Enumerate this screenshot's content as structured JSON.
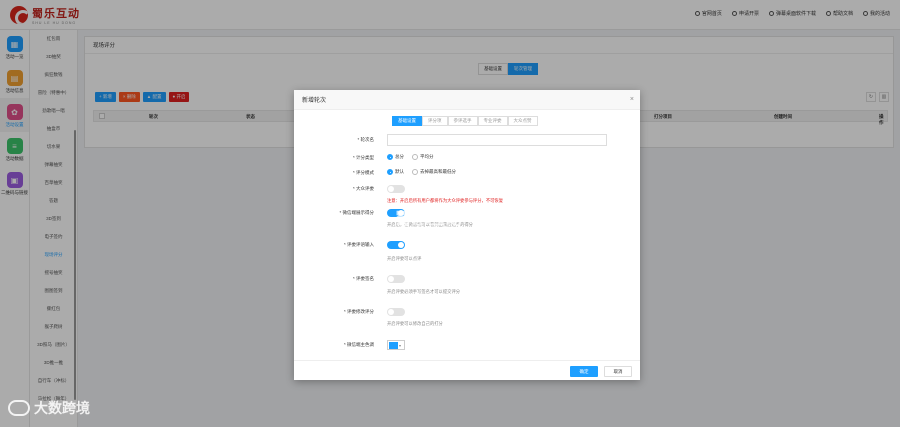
{
  "brand": {
    "name_cn": "蜀乐互动",
    "name_en": "SHU LE HU DONG",
    "color": "#c0201a"
  },
  "topnav": [
    {
      "icon": "home-icon",
      "label": "官网首页"
    },
    {
      "icon": "doc-icon",
      "label": "申请开票"
    },
    {
      "icon": "download-icon",
      "label": "弹幕桌面软件下载"
    },
    {
      "icon": "help-icon",
      "label": "帮助文档"
    },
    {
      "icon": "user-icon",
      "label": "我的活动"
    }
  ],
  "leftnav": [
    {
      "icon": "grid-icon",
      "label": "活动一览",
      "color": "#1e9fff"
    },
    {
      "icon": "document-icon",
      "label": "活动信息",
      "color": "#f0a030"
    },
    {
      "icon": "gear-icon",
      "label": "活动设置",
      "color": "#e0508a",
      "active": true
    },
    {
      "icon": "database-icon",
      "label": "活动数据",
      "color": "#3cc36a"
    },
    {
      "icon": "qrcode-icon",
      "label": "二维码与链接",
      "color": "#9c5de0"
    }
  ],
  "subnav": [
    "红包雨",
    "3D抽奖",
    "疯狂数钱",
    "冒险（特惠中）",
    "劲歌唱一唱",
    "抽盒币",
    "切水果",
    "弹幕抽奖",
    "百草抽奖",
    "答题",
    "3D签到",
    "电子签约",
    "现场评分",
    "摇号抽奖",
    "图图签到",
    "撕红包",
    "猴子爬树",
    "3D照马（图片）",
    "3D推一推",
    "自行车（冲标）",
    "马拉松（舞年）"
  ],
  "subnav_active": 12,
  "page": {
    "breadcrumb": "现场评分",
    "segments": [
      "基础设置",
      "轮次管理"
    ],
    "segment_active": 1,
    "actions": [
      {
        "label": "+ 新增",
        "color": "#1e9fff"
      },
      {
        "label": "× 删除",
        "color": "#ff5722"
      },
      {
        "label": "▲ 配置",
        "color": "#1e9fff"
      },
      {
        "label": "● 开启",
        "color": "#e02020"
      }
    ],
    "columns": [
      "轮次",
      "状态",
      "打分项目",
      "创建时间",
      "操作"
    ]
  },
  "dialog": {
    "title": "新增轮次",
    "close": "×",
    "tabs": [
      "基础设置",
      "评分项",
      "参评选手",
      "专业评委",
      "大众点赞"
    ],
    "tab_active": 0,
    "fields": {
      "round_name": {
        "label": "* 轮次名",
        "value": "",
        "placeholder": ""
      },
      "score_type": {
        "label": "* 计分类型",
        "options": [
          "总分",
          "平均分"
        ],
        "selected": 0
      },
      "judge_mode": {
        "label": "* 评分模式",
        "options": [
          "默认",
          "去掉最高和最低分"
        ],
        "selected": 0
      },
      "public_judge": {
        "label": "* 大众评委",
        "on": false,
        "hint": "注意：开启后所有用户都将作为大众评委参与评分，不可恢复"
      },
      "wechat_show": {
        "label": "* 微信端展示得分",
        "on": true,
        "hint": "开启后，在微信端可以看到出来后选手的得分"
      },
      "judge_login": {
        "label": "* 评委评语输入",
        "on": true,
        "hint": "开启评委可以点评"
      },
      "judge_sign": {
        "label": "* 评委签名",
        "on": false,
        "hint": "开启评委必须手写签名才可以提交评分"
      },
      "judge_edit": {
        "label": "* 评委修改评分",
        "on": false,
        "hint": "开启评委可以修改自己的打分"
      },
      "theme_color": {
        "label": "* 微信端主色调",
        "value": "#1e9fff"
      }
    },
    "ok": "确定",
    "cancel": "取消"
  },
  "watermark": {
    "brand_cn": "蜀乐互动",
    "brand_en": "SHU LE HU DONG",
    "site": "大数跨境"
  }
}
